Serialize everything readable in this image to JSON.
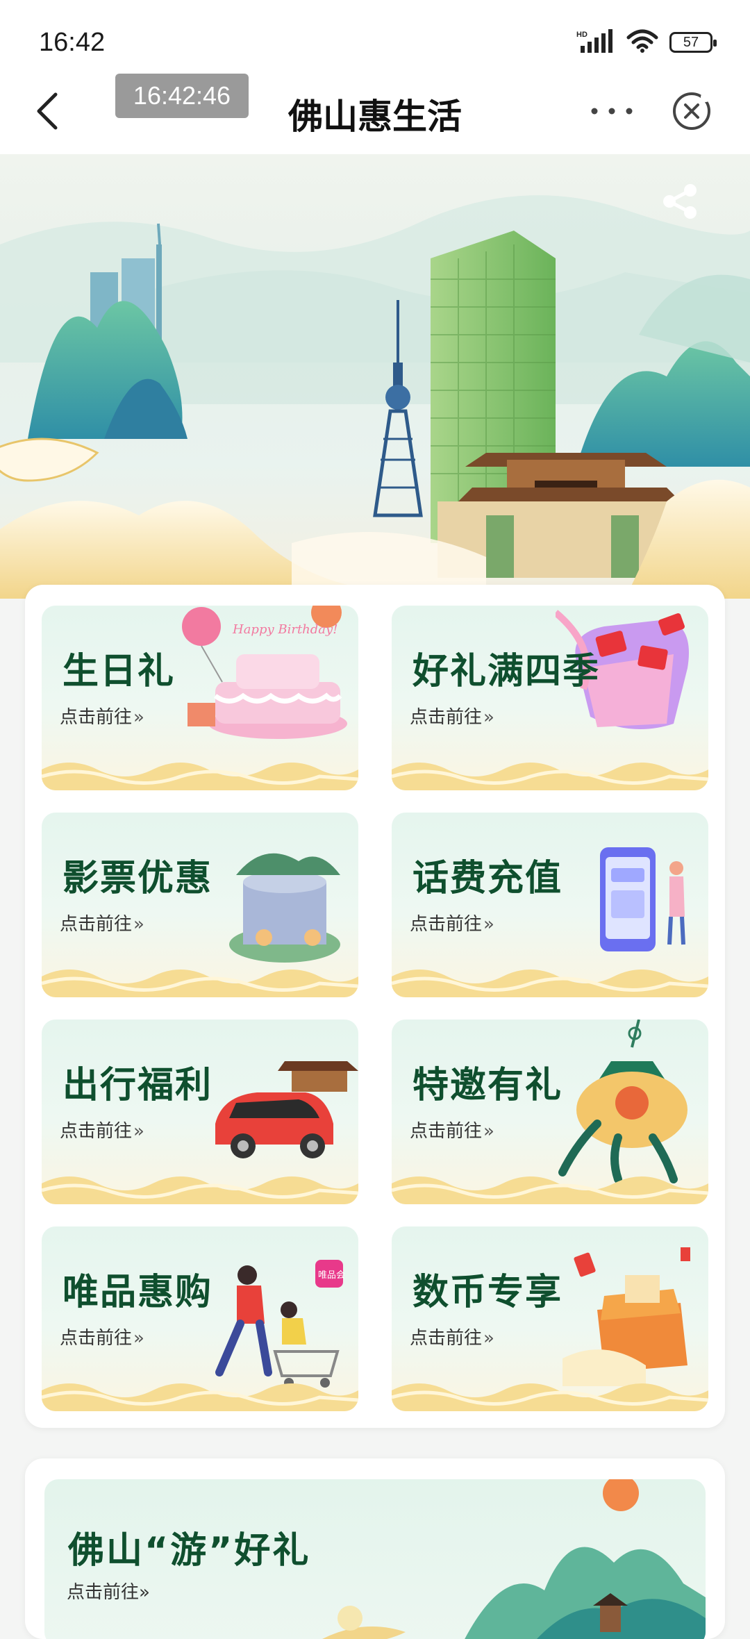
{
  "status_bar": {
    "time": "16:42",
    "network": "HD",
    "battery": "57"
  },
  "nav": {
    "time_badge": "16:42:46",
    "title": "佛山惠生活"
  },
  "tiles": [
    {
      "title": "生日礼",
      "sub": "点击前往",
      "art_text": "Happy Birthday!"
    },
    {
      "title": "好礼满四季",
      "sub": "点击前往"
    },
    {
      "title": "影票优惠",
      "sub": "点击前往"
    },
    {
      "title": "话费充值",
      "sub": "点击前往"
    },
    {
      "title": "出行福利",
      "sub": "点击前往"
    },
    {
      "title": "特邀有礼",
      "sub": "点击前往"
    },
    {
      "title": "唯品惠购",
      "sub": "点击前往",
      "art_text": "唯品会"
    },
    {
      "title": "数币专享",
      "sub": "点击前往"
    }
  ],
  "chevron": "»",
  "bottom_banner": {
    "title": "佛山“游”好礼",
    "sub": "点击前往"
  },
  "colors": {
    "tile_title": "#0f4f2e",
    "accent_green": "#5fb36b",
    "gold": "#f2d58a"
  }
}
